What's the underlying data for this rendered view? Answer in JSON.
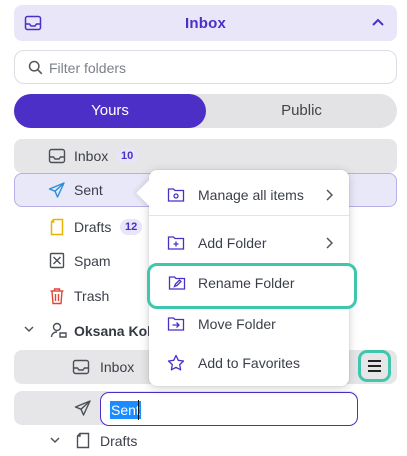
{
  "header": {
    "title": "Inbox"
  },
  "search": {
    "placeholder": "Filter folders",
    "value": ""
  },
  "tabs": [
    {
      "label": "Yours",
      "active": true
    },
    {
      "label": "Public",
      "active": false
    }
  ],
  "folders": [
    {
      "label": "Inbox",
      "count": "10"
    },
    {
      "label": "Sent"
    },
    {
      "label": "Drafts",
      "count": "12"
    },
    {
      "label": "Spam"
    },
    {
      "label": "Trash"
    }
  ],
  "account": {
    "name": "Oksana Koli"
  },
  "subfolders": [
    {
      "label": "Inbox"
    },
    {
      "label": "Sent"
    },
    {
      "label": "Drafts"
    }
  ],
  "rename": {
    "value": "Sent"
  },
  "context_menu": {
    "items": [
      {
        "label": "Manage all items",
        "has_submenu": true
      },
      {
        "label": "Add Folder",
        "has_submenu": true
      },
      {
        "label": "Rename Folder",
        "highlighted": true
      },
      {
        "label": "Move Folder"
      },
      {
        "label": "Add to Favorites"
      }
    ]
  },
  "colors": {
    "accent": "#4b2fc7",
    "highlight": "#3ec7ad",
    "drafts_icon": "#e8b400",
    "trash_icon": "#e0453a",
    "sent_icon": "#2b8fd8"
  }
}
